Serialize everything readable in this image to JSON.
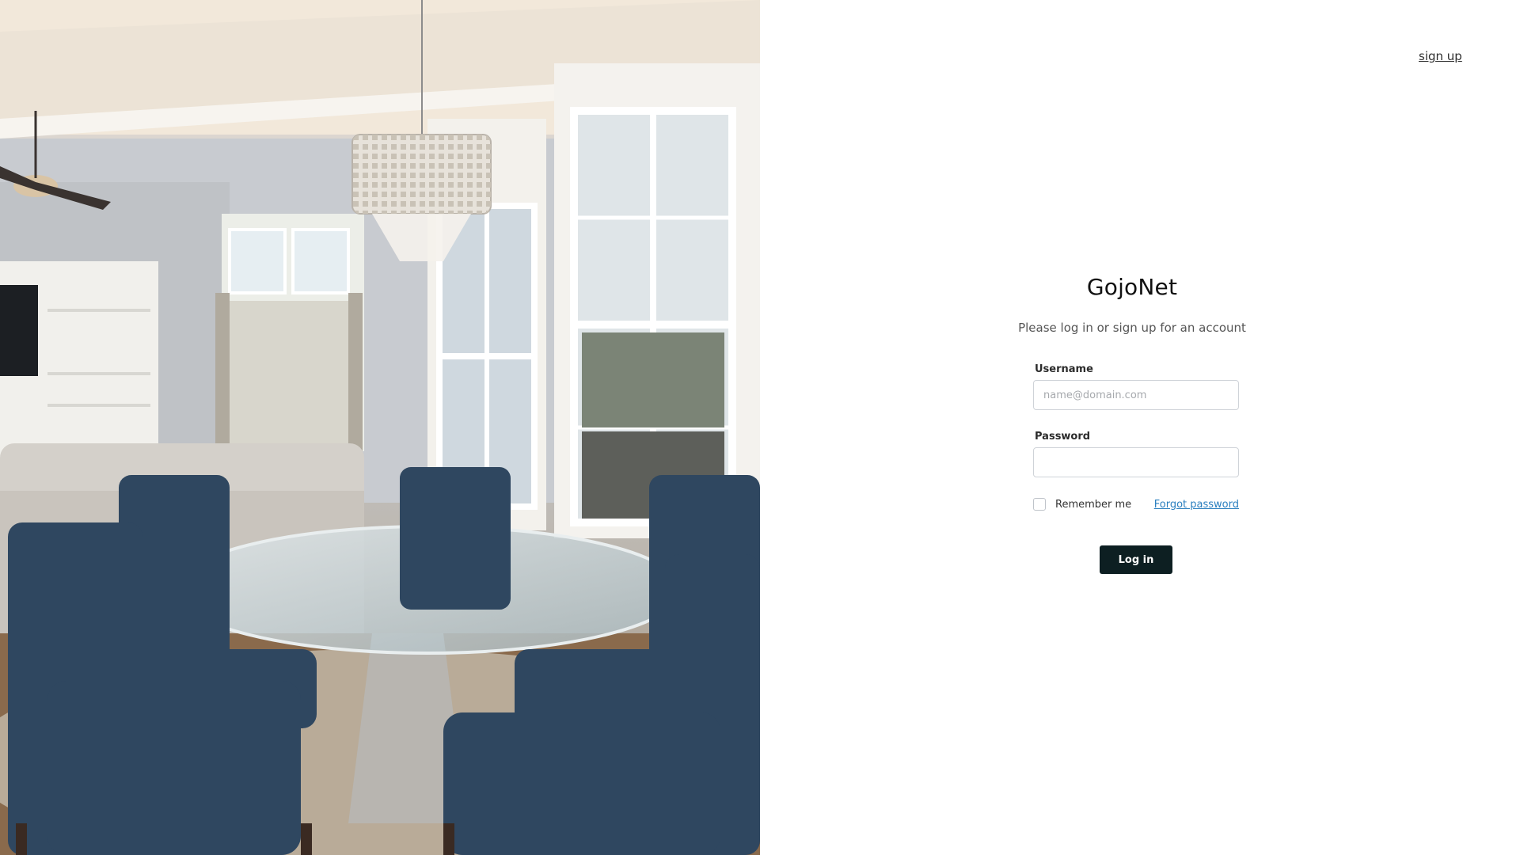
{
  "header": {
    "signup_link": "sign up"
  },
  "login": {
    "brand": "GojoNet",
    "subtitle": "Please log in or sign up for an account",
    "username_label": "Username",
    "username_placeholder": "name@domain.com",
    "username_value": "",
    "password_label": "Password",
    "password_value": "",
    "remember_label": "Remember me",
    "remember_checked": false,
    "forgot_link": "Forgot password",
    "submit_label": "Log in"
  },
  "theme": {
    "button_color": "#0d1f22",
    "link_color": "#2a7fbf"
  },
  "illustration": {
    "subject": "dining room with glass table, blue upholstered chairs and chandelier"
  }
}
